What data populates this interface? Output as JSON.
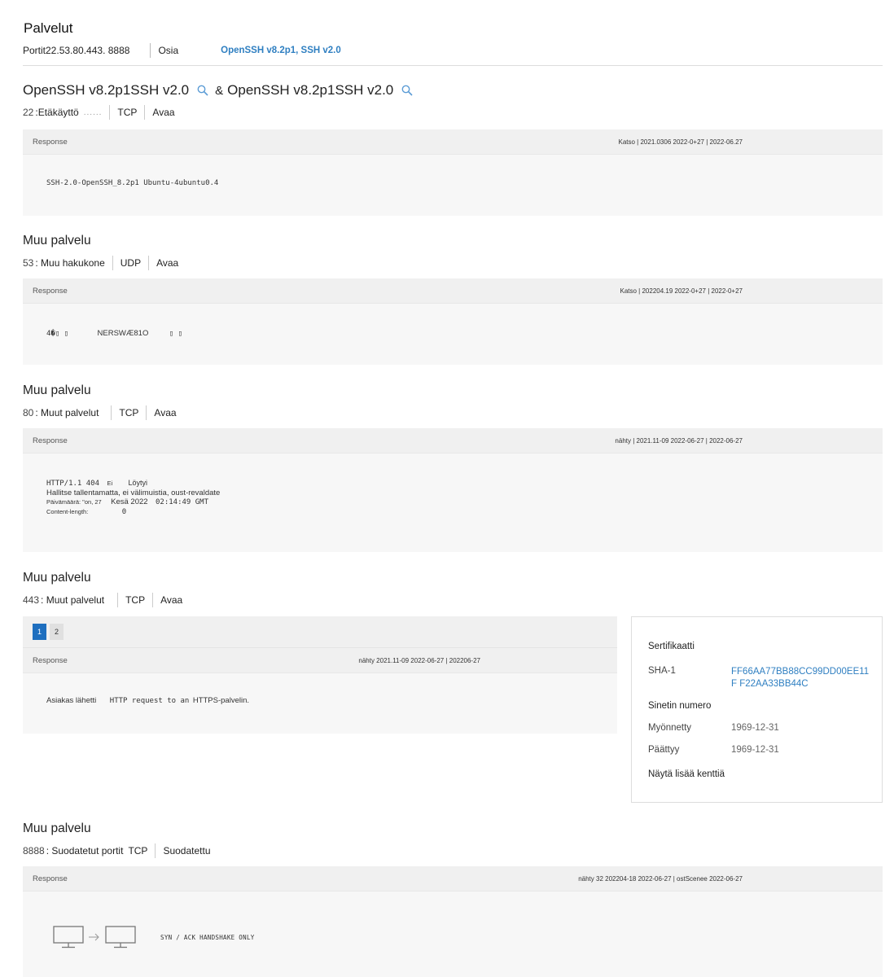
{
  "header": {
    "title": "Palvelut",
    "ports": "Portit22.53.80.443. 8888",
    "parts_label": "Osia",
    "software_link": "OpenSSH v8.2p1, SSH v2.0"
  },
  "service22": {
    "title_a": "OpenSSH v8.2p1SSH v2.0",
    "amp": "&",
    "title_b": "OpenSSH v8.2p1SSH v2.0",
    "port": "22",
    "name": ":Etäkäyttö",
    "dots": "......",
    "protocol": "TCP",
    "state": "Avaa",
    "response_label": "Response",
    "dates": "Katso | 2021.0306 2022-0+27 | 2022-06.27",
    "response": "SSH-2.0-OpenSSH_8.2p1 Ubuntu-4ubuntu0.4"
  },
  "service53": {
    "title": "Muu palvelu",
    "port": "53",
    "name": ": Muu hakukone",
    "protocol": "UDP",
    "state": "Avaa",
    "response_label": "Response",
    "dates": "Katso | 202204.19 2022-0+27 | 2022-0+27",
    "response_a": "4�▯ ▯",
    "response_b": "NERSWÆ81O",
    "response_c": "▯ ▯"
  },
  "service80": {
    "title": "Muu palvelu",
    "port": "80",
    "name": ": Muut palvelut",
    "protocol": "TCP",
    "state": "Avaa",
    "response_label": "Response",
    "dates": "nähty | 2021.11-09 2022-06-27 | 2022-06-27",
    "line1_code": "HTTP/1.1 404",
    "line1_ei": "Ei",
    "line1_found": "Löytyi",
    "line2": "Hallitse tallentamatta, ei välimuistia, oust-revaldate",
    "line3_label": "Päivämäärä: \"on, 27",
    "line3_date": "Kesä 2022",
    "line3_time": "02:14:49 GMT",
    "line4_label": "Content-length:",
    "line4_value": "0"
  },
  "service443": {
    "title": "Muu palvelu",
    "port": "443",
    "name": ": Muut palvelut",
    "protocol": "TCP",
    "state": "Avaa",
    "pages": [
      "1",
      "2"
    ],
    "response_label": "Response",
    "dates": "nähty 2021.11-09 2022-06-27 | 202206-27",
    "response_a": "Asiakas lähetti",
    "response_b": "HTTP request to an",
    "response_c": "HTTPS-palvelin."
  },
  "certificate": {
    "title": "Sertifikaatti",
    "sha_label": "SHA-1",
    "sha_value": "FF66AA77BB88CC99DD00EE11F F22AA33BB44C",
    "serial_label": "Sinetin numero",
    "issued_label": "Myönnetty",
    "issued_value": "1969-12-31",
    "expires_label": "Päättyy",
    "expires_value": "1969-12-31",
    "more_fields": "Näytä lisää kenttiä"
  },
  "service8888": {
    "title": "Muu palvelu",
    "port": "8888",
    "name": ": Suodatetut portit",
    "protocol": "TCP",
    "state": "Suodatettu",
    "response_label": "Response",
    "dates": "nähty 32 202204-18 2022-06-27 | ostScenee 2022-06-27",
    "handshake": "SYN / ACK HANDSHAKE ONLY"
  },
  "colors": {
    "link": "#2f7fc1",
    "active_page": "#1f6fbf",
    "panel_bg": "#f7f7f7"
  }
}
